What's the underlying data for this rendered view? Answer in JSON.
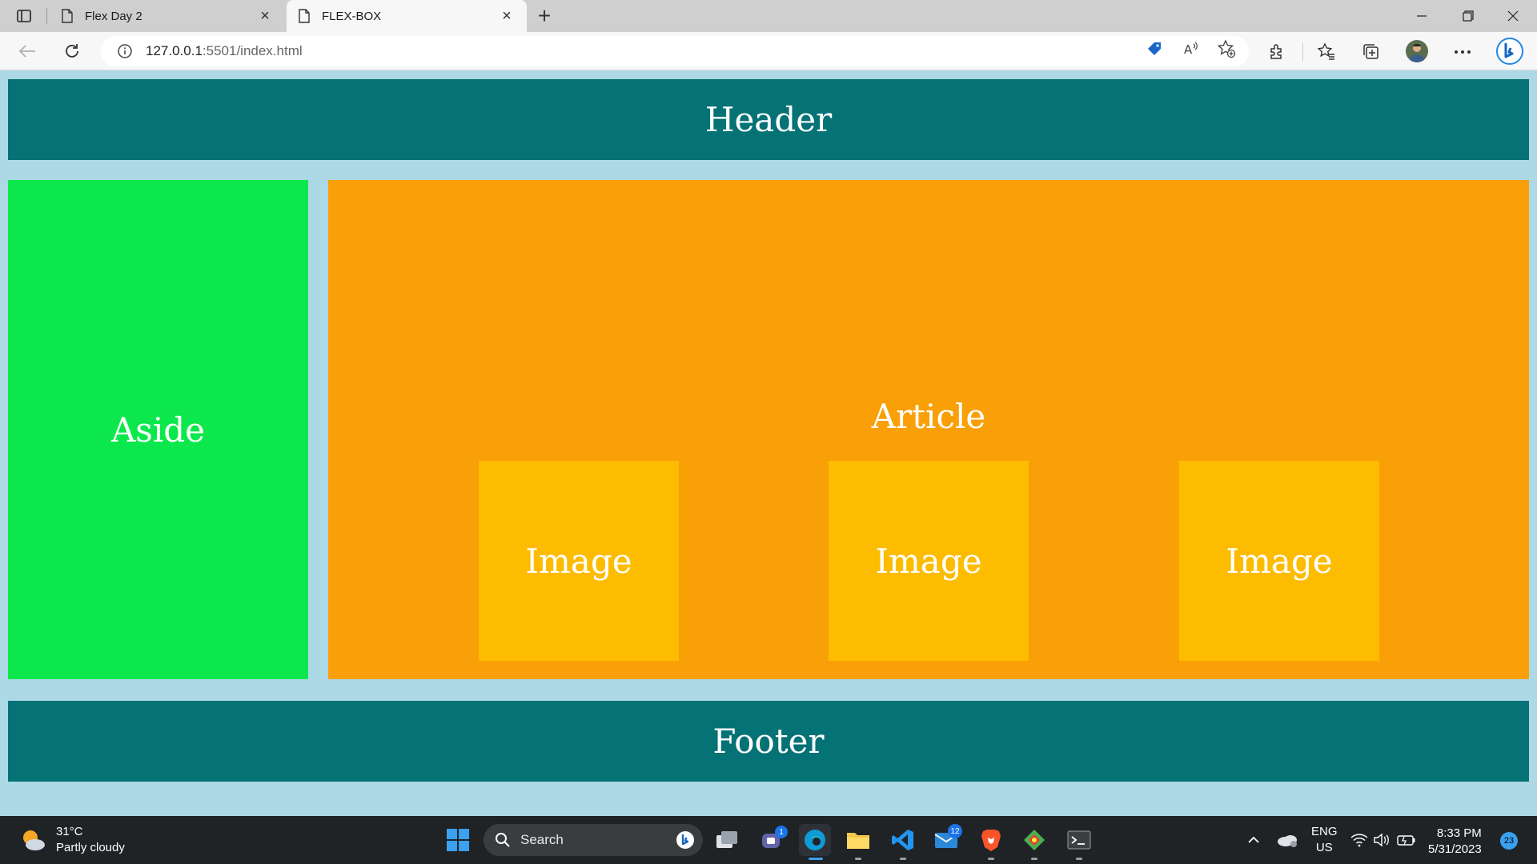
{
  "browser": {
    "tabs": [
      {
        "title": "Flex Day 2",
        "active": false
      },
      {
        "title": "FLEX-BOX",
        "active": true
      }
    ],
    "url_host": "127.0.0.1",
    "url_rest": ":5501/index.html"
  },
  "page": {
    "header": "Header",
    "aside": "Aside",
    "article": "Article",
    "images": [
      "Image",
      "Image",
      "Image"
    ],
    "footer": "Footer",
    "colors": {
      "background": "#add8e6",
      "header": "#057275",
      "aside": "#0ce84c",
      "article": "#f99f07",
      "image": "#fdbc00",
      "footer": "#057275"
    }
  },
  "taskbar": {
    "weather_temp": "31°C",
    "weather_desc": "Partly cloudy",
    "search_label": "Search",
    "teams_badge": "1",
    "mail_badge": "12",
    "lang_top": "ENG",
    "lang_bottom": "US",
    "time": "8:33 PM",
    "date": "5/31/2023",
    "notifications": "23"
  }
}
